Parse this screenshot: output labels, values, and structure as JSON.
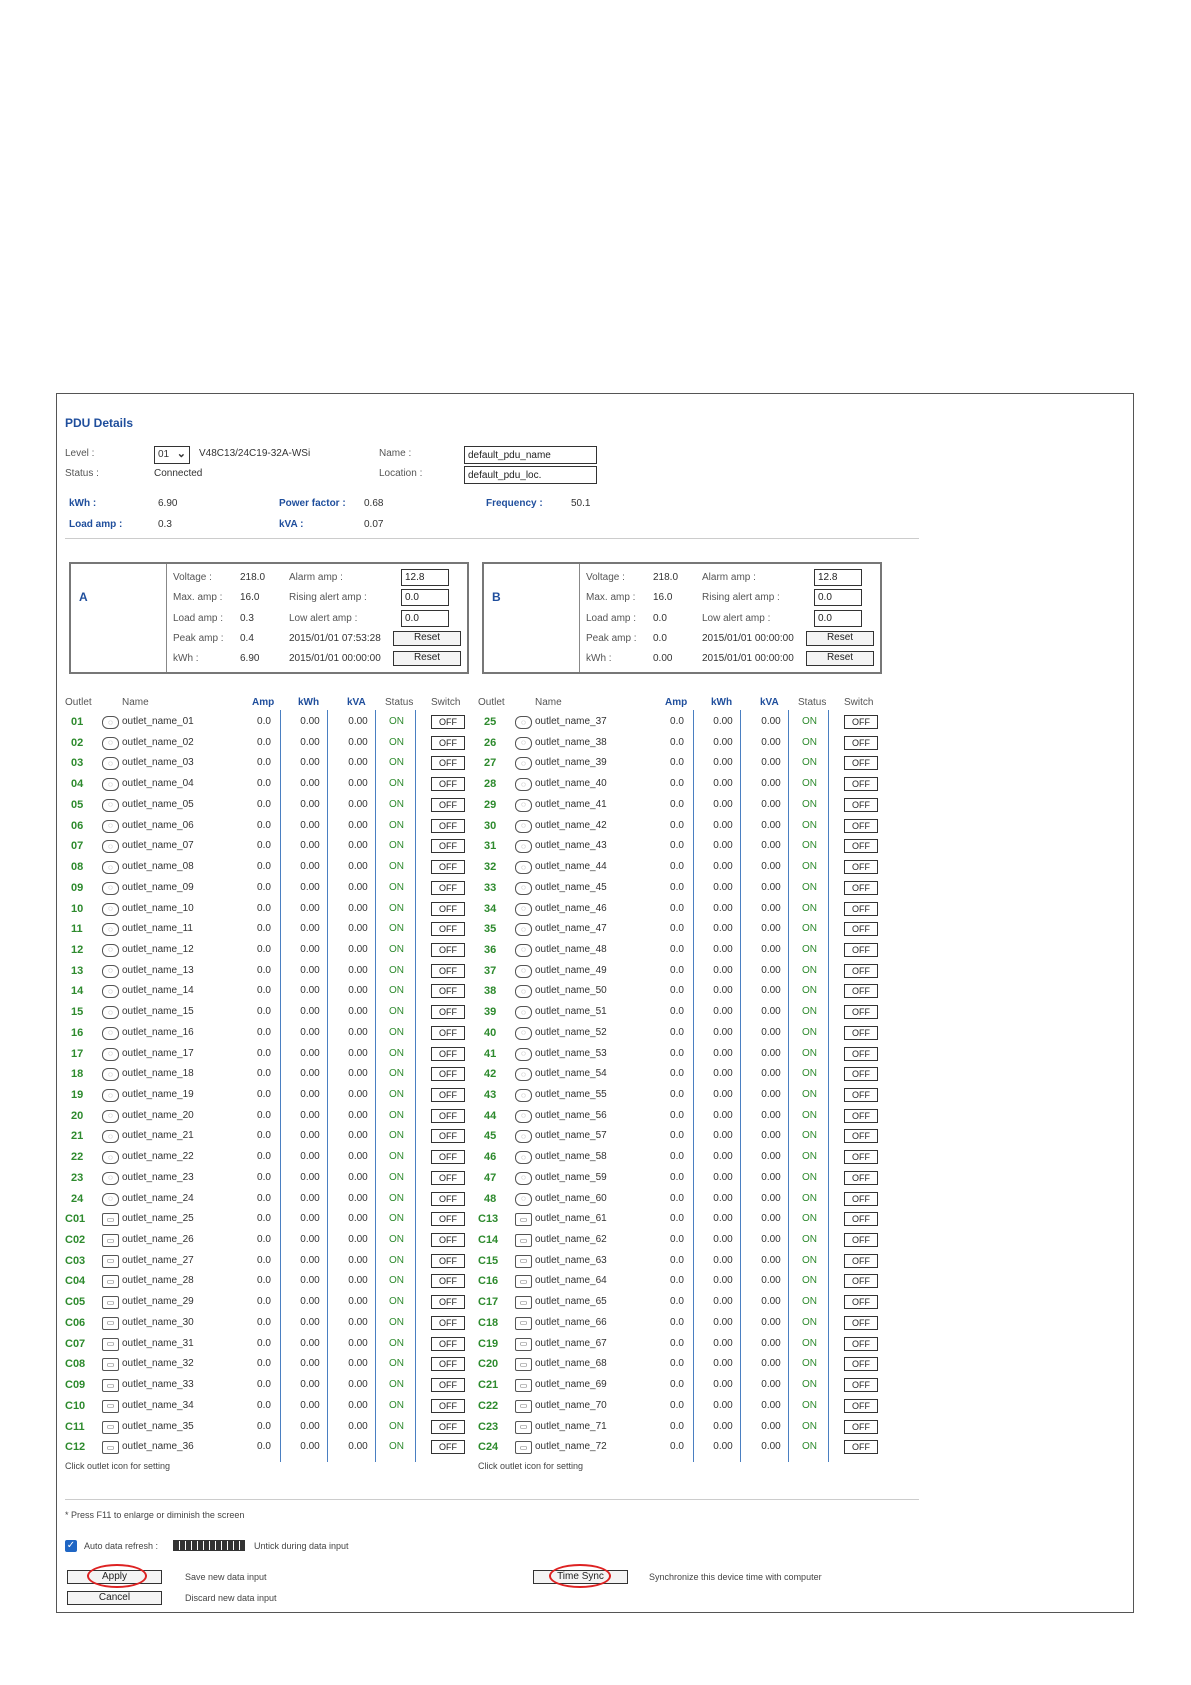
{
  "header": {
    "title": "PDU Details",
    "level_label": "Level :",
    "level_value": "01",
    "model": "V48C13/24C19-32A-WSi",
    "status_label": "Status :",
    "status_value": "Connected",
    "name_label": "Name :",
    "name_value": "default_pdu_name",
    "location_label": "Location :",
    "location_value": "default_pdu_loc."
  },
  "summary": {
    "kwh_label": "kWh :",
    "kwh_value": "6.90",
    "pf_label": "Power factor :",
    "pf_value": "0.68",
    "freq_label": "Frequency :",
    "freq_value": "50.1",
    "load_label": "Load amp :",
    "load_value": "0.3",
    "kva_label": "kVA :",
    "kva_value": "0.07"
  },
  "phases": [
    {
      "name": "A",
      "voltage_label": "Voltage :",
      "voltage": "218.0",
      "max_label": "Max. amp :",
      "max": "16.0",
      "load_label": "Load amp :",
      "load": "0.3",
      "peak_label": "Peak amp :",
      "peak": "0.4",
      "kwh_label": "kWh :",
      "kwh": "6.90",
      "alarm_label": "Alarm amp :",
      "alarm": "12.8",
      "rising_label": "Rising alert amp :",
      "rising": "0.0",
      "low_label": "Low alert amp :",
      "low": "0.0",
      "peak_time": "2015/01/01 07:53:28",
      "kwh_time": "2015/01/01 00:00:00",
      "reset_label": "Reset"
    },
    {
      "name": "B",
      "voltage_label": "Voltage :",
      "voltage": "218.0",
      "max_label": "Max. amp :",
      "max": "16.0",
      "load_label": "Load amp :",
      "load": "0.0",
      "peak_label": "Peak amp :",
      "peak": "0.0",
      "kwh_label": "kWh :",
      "kwh": "0.00",
      "alarm_label": "Alarm amp :",
      "alarm": "12.8",
      "rising_label": "Rising alert amp :",
      "rising": "0.0",
      "low_label": "Low alert amp :",
      "low": "0.0",
      "peak_time": "2015/01/01 00:00:00",
      "kwh_time": "2015/01/01 00:00:00",
      "reset_label": "Reset"
    }
  ],
  "table": {
    "headers": {
      "outlet": "Outlet",
      "name": "Name",
      "amp": "Amp",
      "kwh": "kWh",
      "kva": "kVA",
      "status": "Status",
      "switch": "Switch"
    },
    "defaults": {
      "amp": "0.0",
      "kwh": "0.00",
      "kva": "0.00",
      "status": "ON",
      "switch": "OFF"
    },
    "left": [
      [
        "01",
        "outlet_name_01"
      ],
      [
        "02",
        "outlet_name_02"
      ],
      [
        "03",
        "outlet_name_03"
      ],
      [
        "04",
        "outlet_name_04"
      ],
      [
        "05",
        "outlet_name_05"
      ],
      [
        "06",
        "outlet_name_06"
      ],
      [
        "07",
        "outlet_name_07"
      ],
      [
        "08",
        "outlet_name_08"
      ],
      [
        "09",
        "outlet_name_09"
      ],
      [
        "10",
        "outlet_name_10"
      ],
      [
        "11",
        "outlet_name_11"
      ],
      [
        "12",
        "outlet_name_12"
      ],
      [
        "13",
        "outlet_name_13"
      ],
      [
        "14",
        "outlet_name_14"
      ],
      [
        "15",
        "outlet_name_15"
      ],
      [
        "16",
        "outlet_name_16"
      ],
      [
        "17",
        "outlet_name_17"
      ],
      [
        "18",
        "outlet_name_18"
      ],
      [
        "19",
        "outlet_name_19"
      ],
      [
        "20",
        "outlet_name_20"
      ],
      [
        "21",
        "outlet_name_21"
      ],
      [
        "22",
        "outlet_name_22"
      ],
      [
        "23",
        "outlet_name_23"
      ],
      [
        "24",
        "outlet_name_24"
      ],
      [
        "C01",
        "outlet_name_25"
      ],
      [
        "C02",
        "outlet_name_26"
      ],
      [
        "C03",
        "outlet_name_27"
      ],
      [
        "C04",
        "outlet_name_28"
      ],
      [
        "C05",
        "outlet_name_29"
      ],
      [
        "C06",
        "outlet_name_30"
      ],
      [
        "C07",
        "outlet_name_31"
      ],
      [
        "C08",
        "outlet_name_32"
      ],
      [
        "C09",
        "outlet_name_33"
      ],
      [
        "C10",
        "outlet_name_34"
      ],
      [
        "C11",
        "outlet_name_35"
      ],
      [
        "C12",
        "outlet_name_36"
      ]
    ],
    "right": [
      [
        "25",
        "outlet_name_37"
      ],
      [
        "26",
        "outlet_name_38"
      ],
      [
        "27",
        "outlet_name_39"
      ],
      [
        "28",
        "outlet_name_40"
      ],
      [
        "29",
        "outlet_name_41"
      ],
      [
        "30",
        "outlet_name_42"
      ],
      [
        "31",
        "outlet_name_43"
      ],
      [
        "32",
        "outlet_name_44"
      ],
      [
        "33",
        "outlet_name_45"
      ],
      [
        "34",
        "outlet_name_46"
      ],
      [
        "35",
        "outlet_name_47"
      ],
      [
        "36",
        "outlet_name_48"
      ],
      [
        "37",
        "outlet_name_49"
      ],
      [
        "38",
        "outlet_name_50"
      ],
      [
        "39",
        "outlet_name_51"
      ],
      [
        "40",
        "outlet_name_52"
      ],
      [
        "41",
        "outlet_name_53"
      ],
      [
        "42",
        "outlet_name_54"
      ],
      [
        "43",
        "outlet_name_55"
      ],
      [
        "44",
        "outlet_name_56"
      ],
      [
        "45",
        "outlet_name_57"
      ],
      [
        "46",
        "outlet_name_58"
      ],
      [
        "47",
        "outlet_name_59"
      ],
      [
        "48",
        "outlet_name_60"
      ],
      [
        "C13",
        "outlet_name_61"
      ],
      [
        "C14",
        "outlet_name_62"
      ],
      [
        "C15",
        "outlet_name_63"
      ],
      [
        "C16",
        "outlet_name_64"
      ],
      [
        "C17",
        "outlet_name_65"
      ],
      [
        "C18",
        "outlet_name_66"
      ],
      [
        "C19",
        "outlet_name_67"
      ],
      [
        "C20",
        "outlet_name_68"
      ],
      [
        "C21",
        "outlet_name_69"
      ],
      [
        "C22",
        "outlet_name_70"
      ],
      [
        "C23",
        "outlet_name_71"
      ],
      [
        "C24",
        "outlet_name_72"
      ]
    ],
    "note": "Click outlet icon for setting"
  },
  "footer": {
    "f11_note": "* Press F11 to enlarge or diminish the screen",
    "auto_refresh_label": "Auto data refresh :",
    "untick_note": "Untick during data input",
    "apply_label": "Apply",
    "apply_note": "Save new data input",
    "cancel_label": "Cancel",
    "cancel_note": "Discard new data input",
    "timesync_label": "Time Sync",
    "timesync_note": "Synchronize this device time with computer"
  },
  "colors": {
    "accent": "#1f4e9c",
    "on_green": "#2d8a2d",
    "highlight_red": "#d22222"
  }
}
